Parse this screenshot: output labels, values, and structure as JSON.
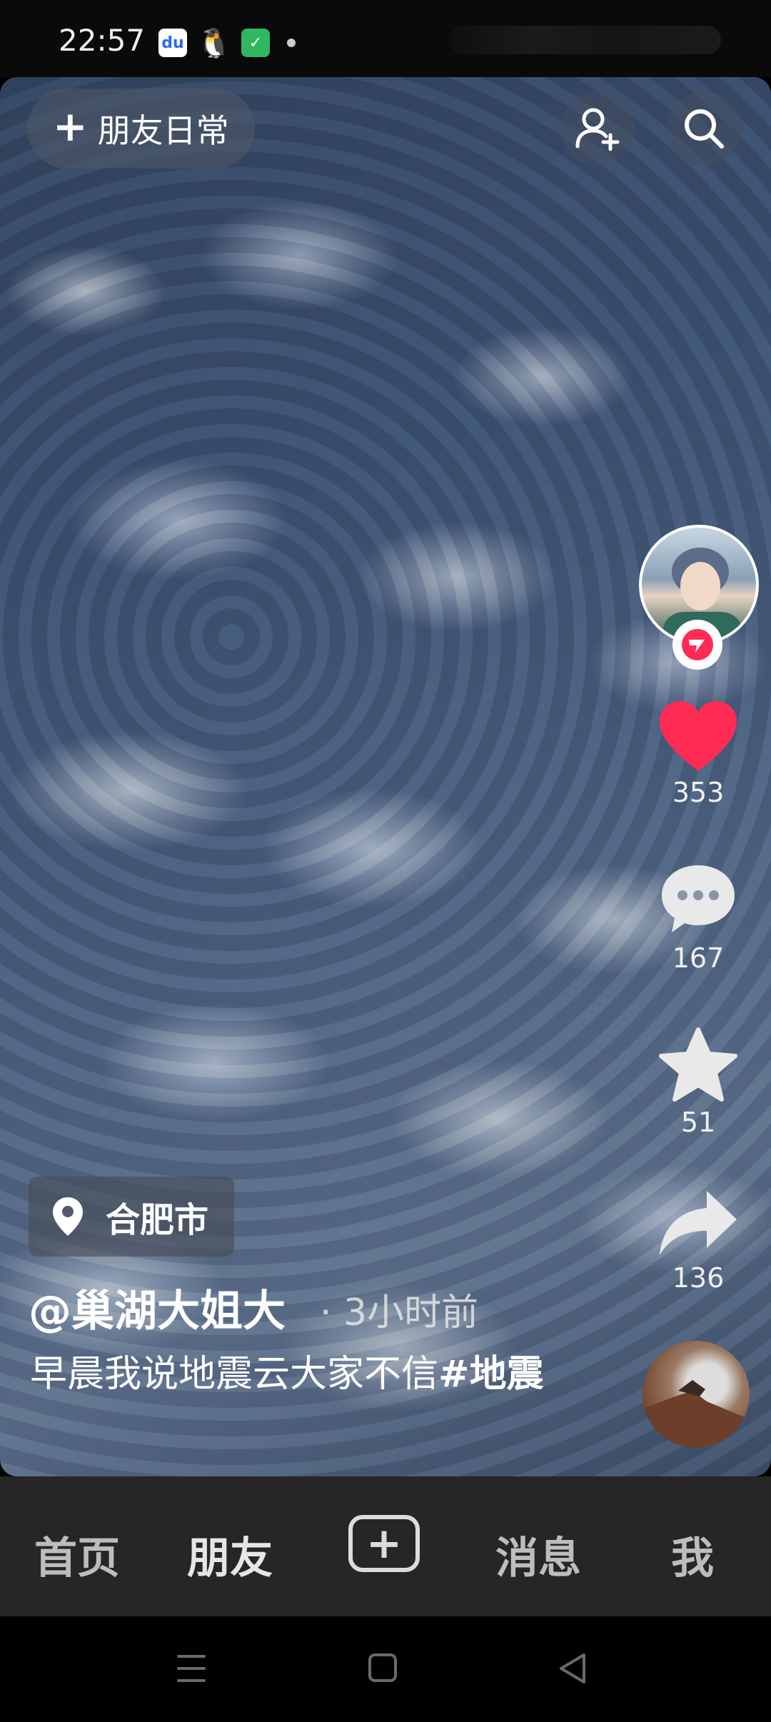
{
  "status_bar": {
    "time": "22:57",
    "icons": [
      "baidu-icon",
      "qq-icon",
      "shield-icon",
      "dot"
    ]
  },
  "top_bar": {
    "friend_daily_label": "朋友日常",
    "add_friend_icon": "add-person-icon",
    "search_icon": "search-icon"
  },
  "right_rail": {
    "likes": "353",
    "comments": "167",
    "favorites": "51",
    "shares": "136",
    "like_color": "#fe2c55"
  },
  "post": {
    "location": "合肥市",
    "author": "@巢湖大姐大",
    "time_ago": "· 3小时前",
    "caption_text": "早晨我说地震云大家不信",
    "caption_hashtag": "#地震"
  },
  "bottom_nav": {
    "home": "首页",
    "friends": "朋友",
    "messages": "消息",
    "me": "我"
  }
}
